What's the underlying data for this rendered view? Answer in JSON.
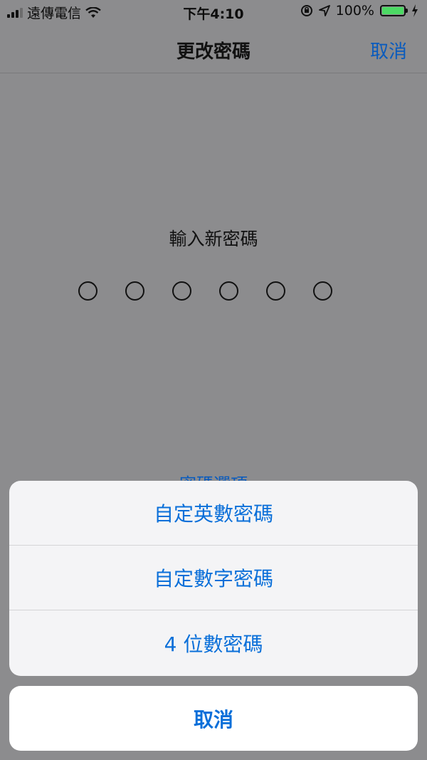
{
  "status_bar": {
    "carrier": "遠傳電信",
    "time": "下午4:10",
    "battery": "100%",
    "battery_level": 1.0,
    "icons": [
      "signal-bars-icon",
      "wifi-icon",
      "orientation-lock-icon",
      "location-arrow-icon",
      "battery-icon",
      "charging-bolt-icon"
    ]
  },
  "nav": {
    "title": "更改密碼",
    "cancel_label": "取消"
  },
  "passcode": {
    "prompt": "輸入新密碼",
    "digit_count": 6,
    "options_link": "密碼選項"
  },
  "action_sheet": {
    "items": [
      {
        "label": "自定英數密碼"
      },
      {
        "label": "自定數字密碼"
      },
      {
        "label": "4 位數密碼"
      }
    ],
    "cancel_label": "取消"
  },
  "colors": {
    "accent": "#0a6fd9",
    "dim_overlay": "#8c8c8e",
    "battery_green": "#4cd964"
  }
}
